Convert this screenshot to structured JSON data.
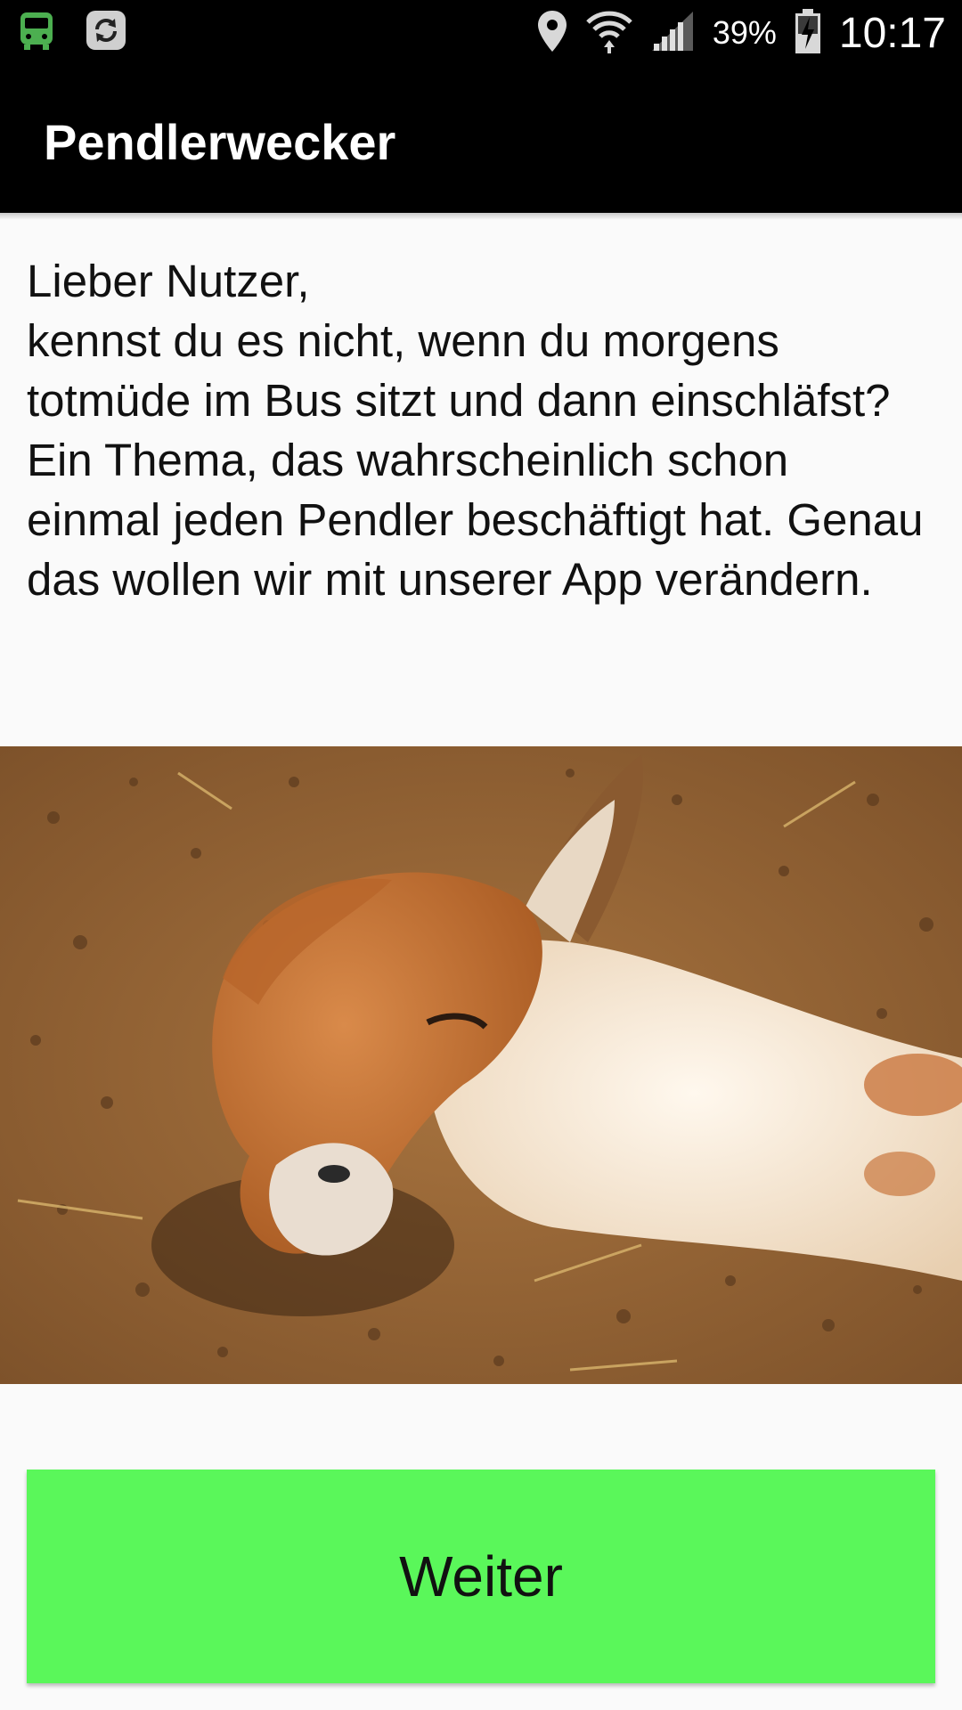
{
  "status_bar": {
    "icons_left": [
      "bus-icon",
      "sync-icon"
    ],
    "icons_right": [
      "location-icon",
      "wifi-icon",
      "signal-icon"
    ],
    "battery_percent": "39%",
    "battery_icon": "battery-charging-icon",
    "time": "10:17"
  },
  "app_bar": {
    "title": "Pendlerwecker",
    "background": "#000000"
  },
  "intro": {
    "text": "Lieber Nutzer,\nkennst du es nicht, wenn du morgens totmüde im Bus sitzt und dann einschläfst? Ein Thema, das wahrscheinlich schon einmal jeden Pendler beschäftigt hat. Genau das wollen wir mit unserer App verändern."
  },
  "image": {
    "subject": "sleeping-alpaca-photo"
  },
  "next_button": {
    "label": "Weiter",
    "color": "#5af75a"
  }
}
